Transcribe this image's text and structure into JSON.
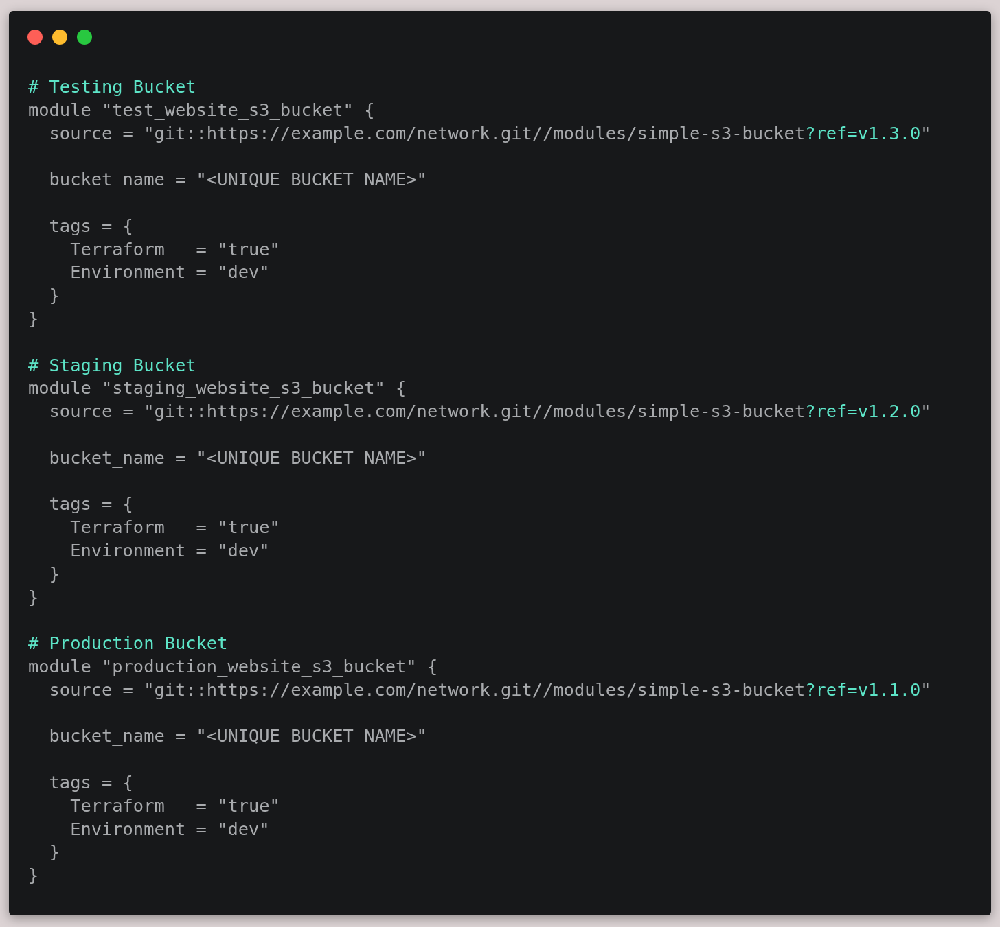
{
  "window": {
    "controls": [
      {
        "color": "#fe5f57"
      },
      {
        "color": "#febc2e"
      },
      {
        "color": "#28c840"
      }
    ]
  },
  "code_lines": [
    {
      "kind": "code",
      "segments": [
        {
          "kind": "comment",
          "text": "# Testing Bucket"
        }
      ]
    },
    {
      "kind": "code",
      "segments": [
        {
          "kind": "plain",
          "text": "module \"test_website_s3_bucket\" {"
        }
      ]
    },
    {
      "kind": "code",
      "segments": [
        {
          "kind": "plain",
          "text": "  source = \"git::https://example.com/network.git//modules/simple-s3-bucket"
        },
        {
          "kind": "highlight",
          "text": "?ref=v1.3.0"
        },
        {
          "kind": "plain",
          "text": "\""
        }
      ]
    },
    {
      "kind": "blank"
    },
    {
      "kind": "code",
      "segments": [
        {
          "kind": "plain",
          "text": "  bucket_name = \"<UNIQUE BUCKET NAME>\""
        }
      ]
    },
    {
      "kind": "blank"
    },
    {
      "kind": "code",
      "segments": [
        {
          "kind": "plain",
          "text": "  tags = {"
        }
      ]
    },
    {
      "kind": "code",
      "segments": [
        {
          "kind": "plain",
          "text": "    Terraform   = \"true\""
        }
      ]
    },
    {
      "kind": "code",
      "segments": [
        {
          "kind": "plain",
          "text": "    Environment = \"dev\""
        }
      ]
    },
    {
      "kind": "code",
      "segments": [
        {
          "kind": "plain",
          "text": "  }"
        }
      ]
    },
    {
      "kind": "code",
      "segments": [
        {
          "kind": "plain",
          "text": "}"
        }
      ]
    },
    {
      "kind": "blank"
    },
    {
      "kind": "code",
      "segments": [
        {
          "kind": "comment",
          "text": "# Staging Bucket"
        }
      ]
    },
    {
      "kind": "code",
      "segments": [
        {
          "kind": "plain",
          "text": "module \"staging_website_s3_bucket\" {"
        }
      ]
    },
    {
      "kind": "code",
      "segments": [
        {
          "kind": "plain",
          "text": "  source = \"git::https://example.com/network.git//modules/simple-s3-bucket"
        },
        {
          "kind": "highlight",
          "text": "?ref=v1.2.0"
        },
        {
          "kind": "plain",
          "text": "\""
        }
      ]
    },
    {
      "kind": "blank"
    },
    {
      "kind": "code",
      "segments": [
        {
          "kind": "plain",
          "text": "  bucket_name = \"<UNIQUE BUCKET NAME>\""
        }
      ]
    },
    {
      "kind": "blank"
    },
    {
      "kind": "code",
      "segments": [
        {
          "kind": "plain",
          "text": "  tags = {"
        }
      ]
    },
    {
      "kind": "code",
      "segments": [
        {
          "kind": "plain",
          "text": "    Terraform   = \"true\""
        }
      ]
    },
    {
      "kind": "code",
      "segments": [
        {
          "kind": "plain",
          "text": "    Environment = \"dev\""
        }
      ]
    },
    {
      "kind": "code",
      "segments": [
        {
          "kind": "plain",
          "text": "  }"
        }
      ]
    },
    {
      "kind": "code",
      "segments": [
        {
          "kind": "plain",
          "text": "}"
        }
      ]
    },
    {
      "kind": "blank"
    },
    {
      "kind": "code",
      "segments": [
        {
          "kind": "comment",
          "text": "# Production Bucket"
        }
      ]
    },
    {
      "kind": "code",
      "segments": [
        {
          "kind": "plain",
          "text": "module \"production_website_s3_bucket\" {"
        }
      ]
    },
    {
      "kind": "code",
      "segments": [
        {
          "kind": "plain",
          "text": "  source = \"git::https://example.com/network.git//modules/simple-s3-bucket"
        },
        {
          "kind": "highlight",
          "text": "?ref=v1.1.0"
        },
        {
          "kind": "plain",
          "text": "\""
        }
      ]
    },
    {
      "kind": "blank"
    },
    {
      "kind": "code",
      "segments": [
        {
          "kind": "plain",
          "text": "  bucket_name = \"<UNIQUE BUCKET NAME>\""
        }
      ]
    },
    {
      "kind": "blank"
    },
    {
      "kind": "code",
      "segments": [
        {
          "kind": "plain",
          "text": "  tags = {"
        }
      ]
    },
    {
      "kind": "code",
      "segments": [
        {
          "kind": "plain",
          "text": "    Terraform   = \"true\""
        }
      ]
    },
    {
      "kind": "code",
      "segments": [
        {
          "kind": "plain",
          "text": "    Environment = \"dev\""
        }
      ]
    },
    {
      "kind": "code",
      "segments": [
        {
          "kind": "plain",
          "text": "  }"
        }
      ]
    },
    {
      "kind": "code",
      "segments": [
        {
          "kind": "plain",
          "text": "}"
        }
      ]
    }
  ]
}
